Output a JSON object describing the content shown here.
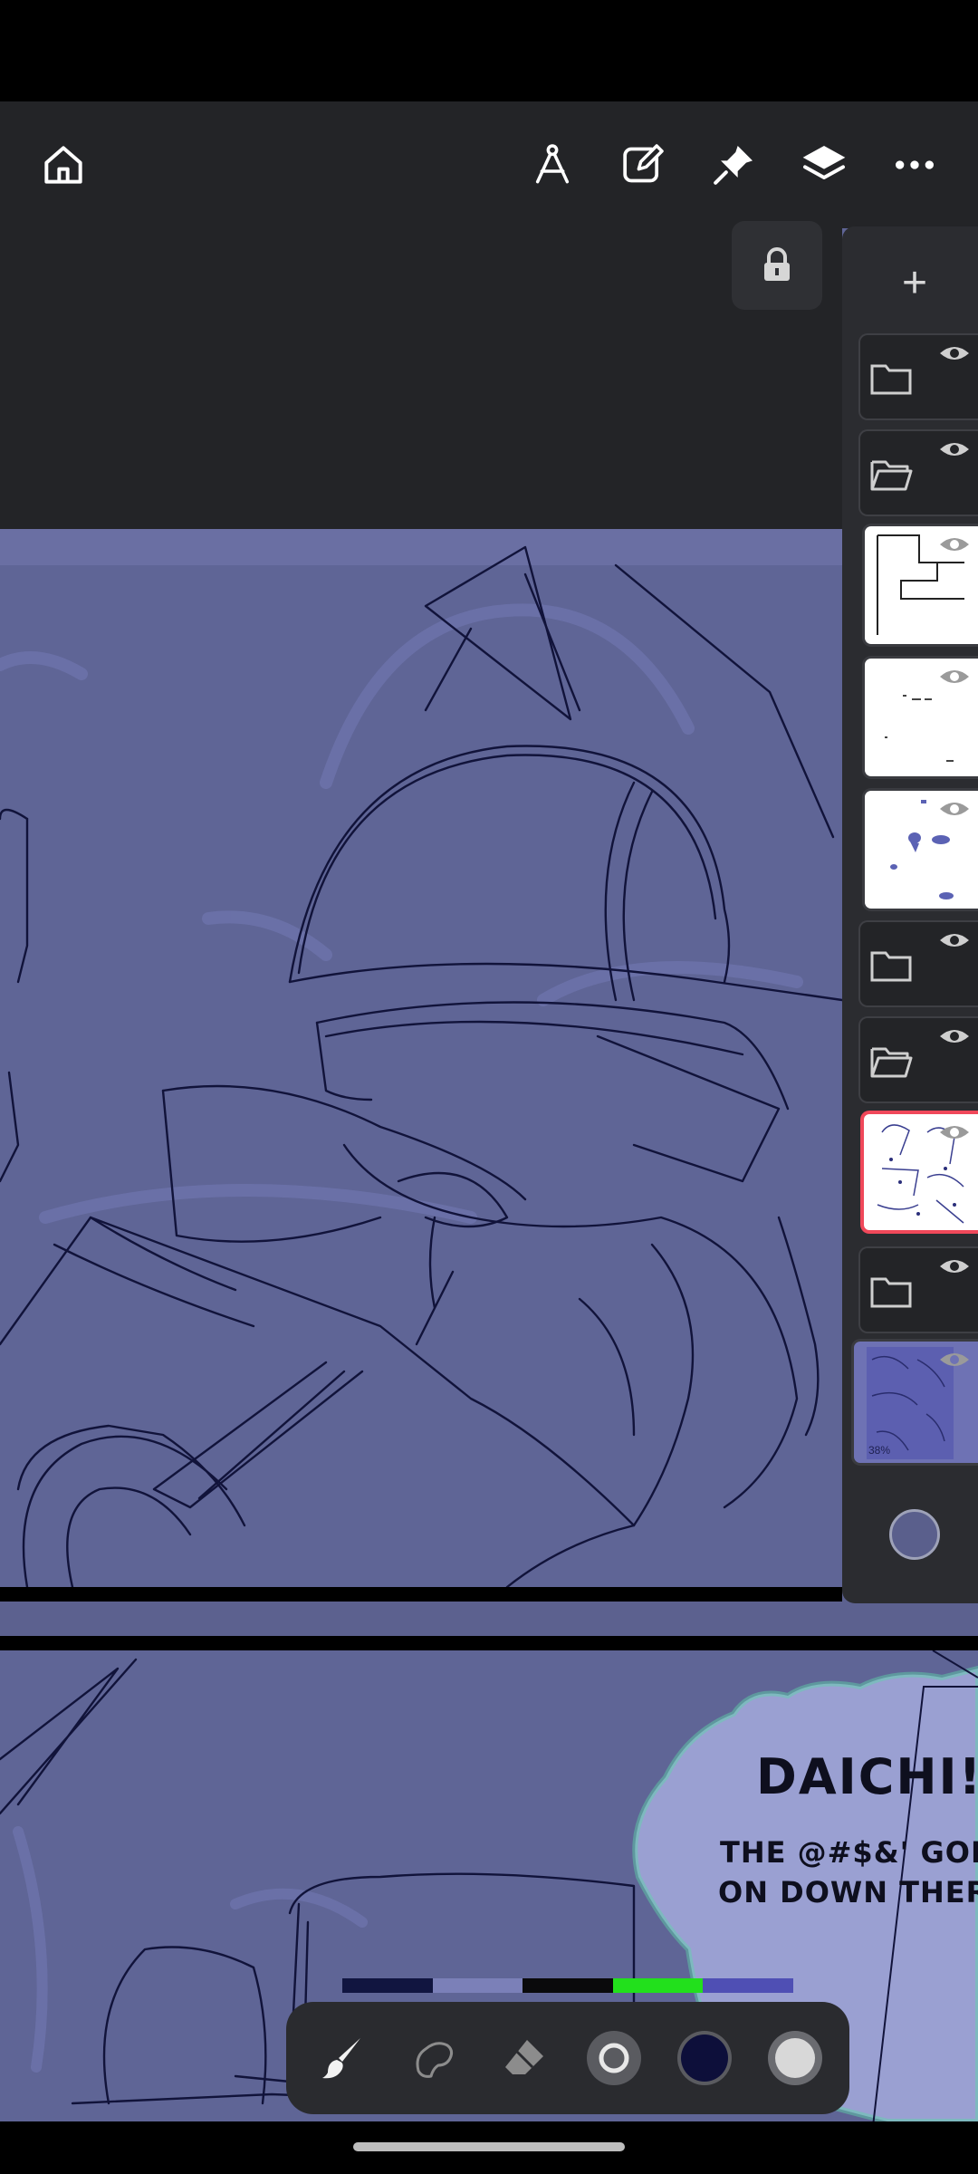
{
  "toolbar": {
    "icons": [
      "home-icon",
      "compass-icon",
      "edit-icon",
      "pin-icon",
      "layers-icon",
      "more-icon"
    ]
  },
  "layers_panel": {
    "add_symbol": "+",
    "layers": [
      {
        "type": "folder",
        "state": "closed",
        "visible": true
      },
      {
        "type": "folder",
        "state": "open",
        "visible": true
      },
      {
        "type": "layer",
        "content": "panel borders",
        "visible": true
      },
      {
        "type": "layer",
        "content": "sparse marks",
        "visible": true
      },
      {
        "type": "layer",
        "content": "blue blobs",
        "visible": true
      },
      {
        "type": "folder",
        "state": "closed",
        "visible": true
      },
      {
        "type": "folder",
        "state": "open",
        "visible": true
      },
      {
        "type": "layer",
        "content": "sketch page",
        "visible": true,
        "selected": true
      },
      {
        "type": "folder",
        "state": "closed",
        "visible": true
      },
      {
        "type": "layer",
        "content": "blue sketch page",
        "visible": true,
        "opacity_label": "38%"
      }
    ]
  },
  "speech_bubble": {
    "main": "DAICHI!?",
    "line1": "THE @#$&' GOIN",
    "line2": "ON DOWN THERE"
  },
  "palette": [
    "#111540",
    "#7b80b8",
    "#0a0a0c",
    "#22e01c",
    "#4f4fb4"
  ],
  "bottom_toolbar": {
    "tools": [
      "brush-tool",
      "smudge-tool",
      "eraser-tool",
      "brush-size",
      "color",
      "opacity"
    ],
    "current_color": "#0d0f3a",
    "accent": "#f0485a"
  }
}
